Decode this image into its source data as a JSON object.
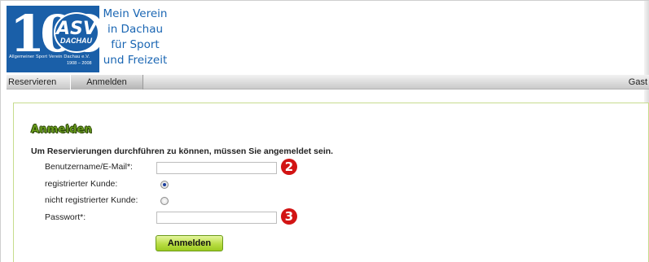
{
  "header": {
    "logo": {
      "number": "100",
      "club_short": "ASV",
      "club_city": "DACHAU",
      "club_full": "Allgemeiner Sport Verein Dachau e.V.",
      "years": "1908 – 2008"
    },
    "slogan_lines": [
      "Mein Verein",
      "in Dachau",
      "für Sport",
      "und Freizeit"
    ]
  },
  "nav": {
    "items": [
      {
        "label": "Reservieren"
      },
      {
        "label": "Anmelden"
      }
    ],
    "user_label": "Gast"
  },
  "login": {
    "title": "Anmelden",
    "intro": "Um Reservierungen durchführen zu können, müssen Sie angemeldet sein.",
    "username_label": "Benutzername/E-Mail*:",
    "username_value": "",
    "registered_label": "registrierter Kunde:",
    "unregistered_label": "nicht registrierter Kunde:",
    "password_label": "Passwort*:",
    "password_value": "",
    "submit_label": "Anmelden",
    "markers": [
      "2",
      "3"
    ]
  },
  "colors": {
    "brand_blue": "#1a5fa8",
    "accent_green": "#9ccb21",
    "marker_red": "#d21414"
  }
}
